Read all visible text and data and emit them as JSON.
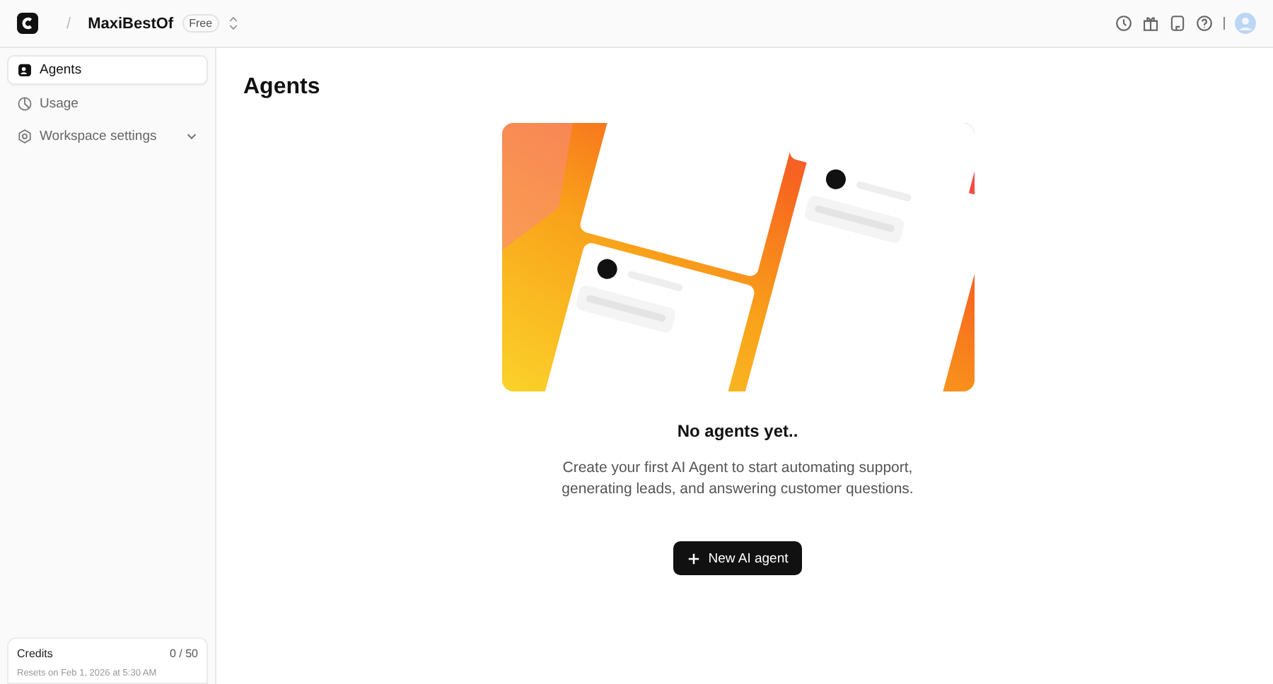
{
  "topbar": {
    "separator": "/",
    "workspace": "MaxiBestOf",
    "plan": "Free"
  },
  "sidebar": {
    "items": [
      {
        "label": "Agents",
        "kind": "agent",
        "selected": true
      },
      {
        "label": "Usage",
        "kind": "usage",
        "selected": false
      },
      {
        "label": "Workspace settings",
        "kind": "settings",
        "selected": false,
        "expandable": true
      }
    ],
    "credits": {
      "label": "Credits",
      "value": "0 / 50",
      "note": "Resets on Feb 1, 2026 at 5:30 AM"
    }
  },
  "page": {
    "title": "Agents",
    "empty_title": "No agents yet..",
    "empty_text": "Create your first AI Agent to start automating support, generating leads, and answering customer questions.",
    "button": "New AI agent"
  }
}
